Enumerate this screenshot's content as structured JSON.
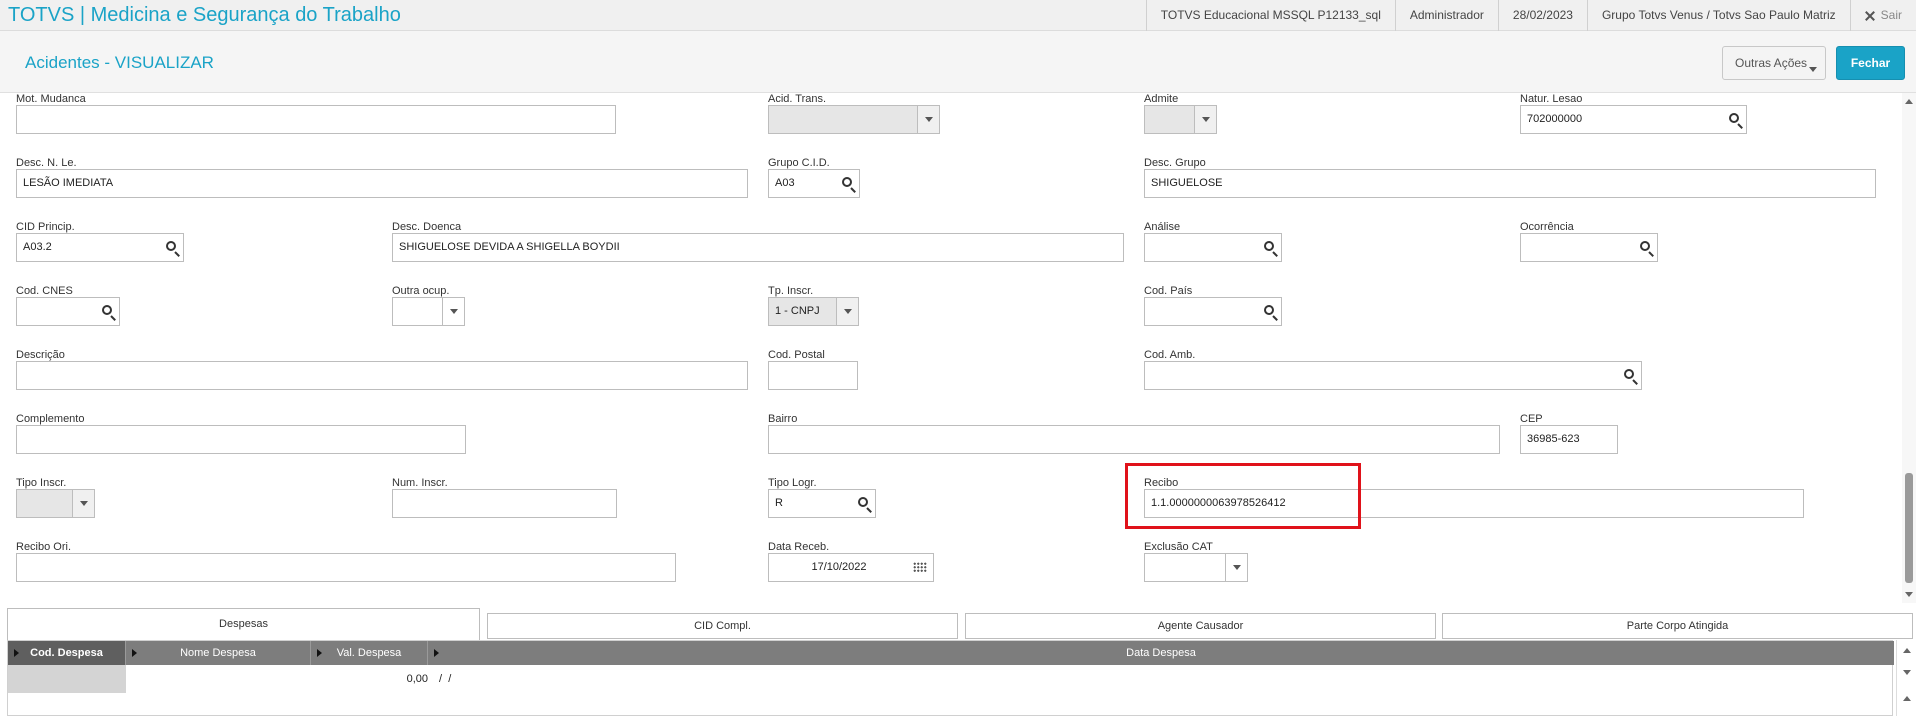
{
  "app": {
    "title": "TOTVS | Medicina e Segurança do Trabalho",
    "environment": "TOTVS Educacional MSSQL P12133_sql",
    "user": "Administrador",
    "date": "28/02/2023",
    "company": "Grupo Totvs Venus / Totvs Sao Paulo Matriz",
    "exit_label": "Sair"
  },
  "header": {
    "page_title": "Acidentes - VISUALIZAR",
    "outras_acoes_label": "Outras Ações",
    "fechar_label": "Fechar"
  },
  "form": {
    "mot_mudanca": {
      "label": "Mot. Mudanca",
      "value": ""
    },
    "acid_trans": {
      "label": "Acid. Trans.",
      "value": ""
    },
    "admite": {
      "label": "Admite",
      "value": ""
    },
    "natur_lesao": {
      "label": "Natur. Lesao",
      "value": "702000000"
    },
    "desc_n_le": {
      "label": "Desc. N. Le.",
      "value": "LESÃO IMEDIATA"
    },
    "grupo_cid": {
      "label": "Grupo C.I.D.",
      "value": "A03"
    },
    "desc_grupo": {
      "label": "Desc. Grupo",
      "value": "SHIGUELOSE"
    },
    "cid_princip": {
      "label": "CID Princip.",
      "value": "A03.2"
    },
    "desc_doenca": {
      "label": "Desc. Doenca",
      "value": "SHIGUELOSE DEVIDA A SHIGELLA BOYDII"
    },
    "analise": {
      "label": "Análise",
      "value": ""
    },
    "ocorrencia": {
      "label": "Ocorrência",
      "value": ""
    },
    "cod_cnes": {
      "label": "Cod. CNES",
      "value": ""
    },
    "outra_ocup": {
      "label": "Outra ocup.",
      "value": ""
    },
    "tp_inscr": {
      "label": "Tp. Inscr.",
      "value": "1 - CNPJ"
    },
    "cod_pais": {
      "label": "Cod. País",
      "value": ""
    },
    "descricao": {
      "label": "Descrição",
      "value": ""
    },
    "cod_postal": {
      "label": "Cod. Postal",
      "value": ""
    },
    "cod_amb": {
      "label": "Cod. Amb.",
      "value": ""
    },
    "complemento": {
      "label": "Complemento",
      "value": ""
    },
    "bairro": {
      "label": "Bairro",
      "value": ""
    },
    "cep": {
      "label": "CEP",
      "value": "36985-623"
    },
    "tipo_inscr": {
      "label": "Tipo Inscr.",
      "value": ""
    },
    "num_inscr": {
      "label": "Num. Inscr.",
      "value": ""
    },
    "tipo_logr": {
      "label": "Tipo Logr.",
      "value": "R"
    },
    "recibo": {
      "label": "Recibo",
      "value": "1.1.0000000063978526412"
    },
    "recibo_ori": {
      "label": "Recibo Ori.",
      "value": ""
    },
    "data_receb": {
      "label": "Data Receb.",
      "value": "17/10/2022"
    },
    "exclusao_cat": {
      "label": "Exclusão CAT",
      "value": ""
    }
  },
  "tabs": [
    {
      "label": "Despesas",
      "active": true
    },
    {
      "label": "CID Compl.",
      "active": false
    },
    {
      "label": "Agente Causador",
      "active": false
    },
    {
      "label": "Parte Corpo Atingida",
      "active": false
    }
  ],
  "grid": {
    "columns": [
      "Cod. Despesa",
      "Nome Despesa",
      "Val. Despesa",
      "Data Despesa"
    ],
    "rows": [
      {
        "cod": "",
        "nome": "",
        "val": "0,00",
        "data": " /  /"
      }
    ]
  },
  "colors": {
    "accent": "#1aa3c7",
    "highlight": "#e0121a"
  }
}
